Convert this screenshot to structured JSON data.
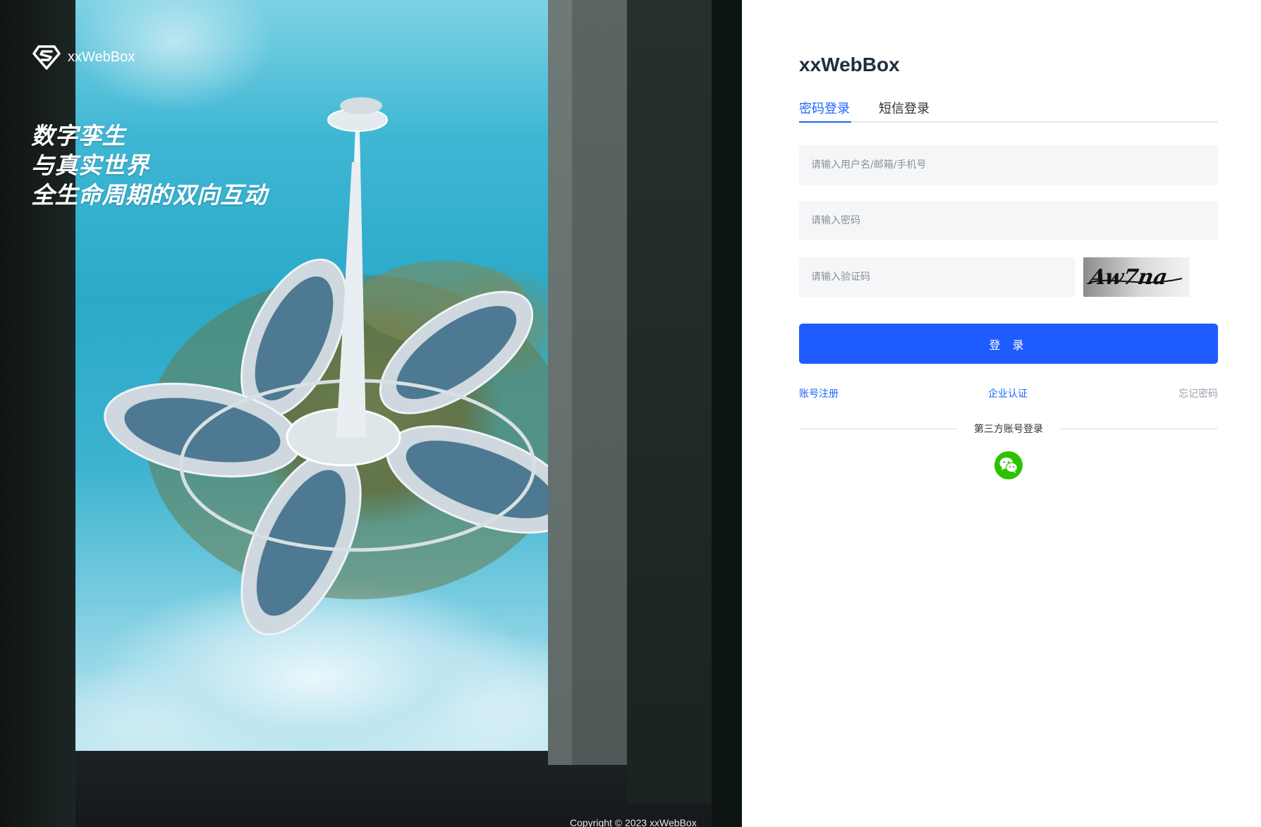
{
  "brand": {
    "name": "xxWebBox",
    "logo_icon": "diamond-s-logo-icon"
  },
  "hero": {
    "slogan": [
      "数字孪生",
      "与真实世界",
      "全生命周期的双向互动"
    ]
  },
  "footer": {
    "copyright": "Copyright © 2023 xxWebBox"
  },
  "login": {
    "title": "xxWebBox",
    "tabs": [
      {
        "label": "密码登录",
        "active": true
      },
      {
        "label": "短信登录",
        "active": false
      }
    ],
    "fields": {
      "username": {
        "placeholder": "请输入用户名/邮箱/手机号",
        "value": ""
      },
      "password": {
        "placeholder": "请输入密码",
        "value": ""
      },
      "captcha": {
        "placeholder": "请输入验证码",
        "value": "",
        "image_text": "Aw7na"
      }
    },
    "submit_label": "登 录",
    "links": {
      "register": "账号注册",
      "enterprise": "企业认证",
      "forgot": "忘记密码"
    },
    "third_party": {
      "label": "第三方账号登录",
      "providers": [
        {
          "name": "wechat",
          "icon": "wechat-icon",
          "color": "#2dc100"
        }
      ]
    }
  },
  "colors": {
    "primary": "#1f5cff",
    "link": "#1a66ff",
    "input_bg": "#f5f6f8",
    "wechat": "#2dc100"
  }
}
